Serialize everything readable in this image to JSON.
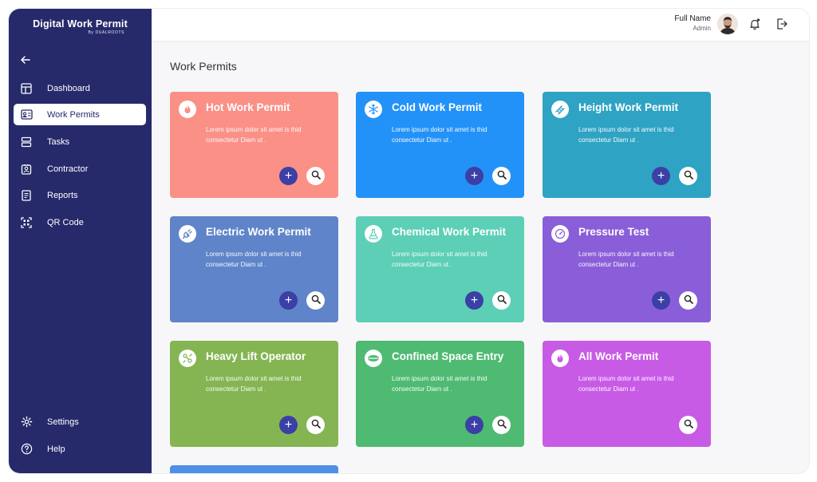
{
  "brand": {
    "title": "Digital Work Permit",
    "subtitle": "By DUALROOTS"
  },
  "sidebar": {
    "items": [
      {
        "label": "Dashboard",
        "icon": "dashboard-icon"
      },
      {
        "label": "Work Permits",
        "icon": "id-card-icon",
        "active": true
      },
      {
        "label": "Tasks",
        "icon": "tasks-icon"
      },
      {
        "label": "Contractor",
        "icon": "contractor-icon"
      },
      {
        "label": "Reports",
        "icon": "reports-icon"
      },
      {
        "label": "QR Code",
        "icon": "qr-code-icon"
      }
    ],
    "bottom": [
      {
        "label": "Settings",
        "icon": "gear-icon"
      },
      {
        "label": "Help",
        "icon": "help-icon"
      }
    ]
  },
  "header": {
    "user_name": "Full Name",
    "user_role": "Admin"
  },
  "main": {
    "title": "Work Permits",
    "cards": [
      {
        "title": "Hot Work Permit",
        "description": "Lorem ipsum dolor sit amet  is thid consectetur Diam ut .",
        "color": "#fa9086",
        "icon": "flame-icon",
        "has_add": true
      },
      {
        "title": "Cold Work Permit",
        "description": "Lorem ipsum dolor sit amet  is thid consectetur Diam ut .",
        "color": "#2392f8",
        "icon": "snowflake-icon",
        "has_add": true
      },
      {
        "title": "Height Work Permit",
        "description": "Lorem ipsum dolor sit amet  is thid consectetur Diam ut .",
        "color": "#2ea3c4",
        "icon": "ladder-icon",
        "has_add": true
      },
      {
        "title": "Electric Work Permit",
        "description": "Lorem ipsum dolor sit amet  is thid consectetur Diam ut .",
        "color": "#5f84c9",
        "icon": "plug-icon",
        "has_add": true
      },
      {
        "title": "Chemical Work Permit",
        "description": "Lorem ipsum dolor sit amet  is thid consectetur Diam ut .",
        "color": "#5ccfb6",
        "icon": "flask-icon",
        "has_add": true
      },
      {
        "title": "Pressure Test",
        "description": "Lorem ipsum dolor sit amet  is thid consectetur Diam ut .",
        "color": "#8a5ed8",
        "icon": "gauge-icon",
        "has_add": true
      },
      {
        "title": "Heavy Lift Operator",
        "description": "Lorem ipsum dolor sit amet  is thid consectetur Diam ut .",
        "color": "#84b552",
        "icon": "crane-icon",
        "has_add": true
      },
      {
        "title": "Confined Space Entry",
        "description": "Lorem ipsum dolor sit amet  is thid consectetur Diam ut .",
        "color": "#4fba72",
        "icon": "manhole-icon",
        "has_add": true
      },
      {
        "title": "All Work Permit",
        "description": "Lorem ipsum dolor sit amet  is thid consectetur Diam ut .",
        "color": "#c85be6",
        "icon": "flame-icon",
        "has_add": false
      }
    ],
    "add_symbol": "+"
  }
}
